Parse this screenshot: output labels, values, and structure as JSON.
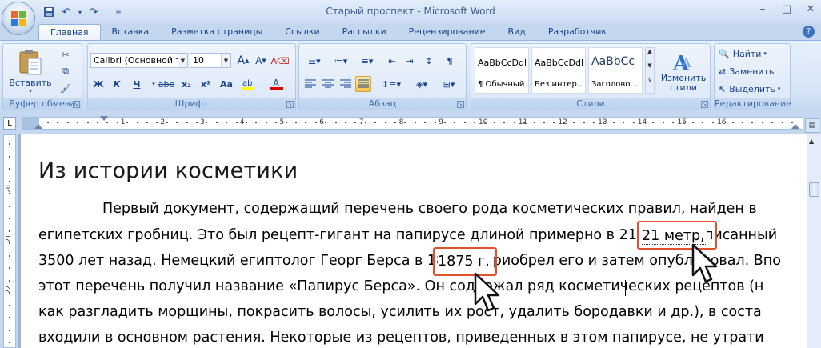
{
  "window": {
    "title": "Старый проспект - Microsoft Word",
    "controls": [
      "–",
      "□",
      "✕"
    ]
  },
  "tabs": [
    "Главная",
    "Вставка",
    "Разметка страницы",
    "Ссылки",
    "Рассылки",
    "Рецензирование",
    "Вид",
    "Разработчик"
  ],
  "ribbon": {
    "clipboard": {
      "label": "Буфер обмена",
      "paste": "Вставить"
    },
    "font": {
      "label": "Шрифт",
      "name": "Calibri (Основной те",
      "size": "10",
      "bold": "Ж",
      "italic": "К",
      "underline": "Ч",
      "strike": "abe",
      "sub": "x₂",
      "sup": "x²",
      "case": "Aa",
      "grow": "A",
      "shrink": "A",
      "clear": "A"
    },
    "paragraph": {
      "label": "Абзац"
    },
    "styles": {
      "label": "Стили",
      "items": [
        {
          "sample": "AaBbCcDdI",
          "name": "¶ Обычный"
        },
        {
          "sample": "AaBbCcDdI",
          "name": "Без интер..."
        },
        {
          "sample": "AaBbCc",
          "name": "Заголово..."
        }
      ],
      "change": "Изменить стили"
    },
    "editing": {
      "label": "Редактирование",
      "find": "Найти",
      "replace": "Заменить",
      "select": "Выделить"
    }
  },
  "ruler": {
    "corner": "L",
    "numbers": [
      "1",
      "2",
      "3",
      "4",
      "5",
      "6",
      "7",
      "8",
      "9",
      "10",
      "11",
      "12",
      "13",
      "14",
      "15",
      "16"
    ],
    "vnumbers": [
      "20",
      "21",
      "22"
    ]
  },
  "document": {
    "title": "Из истории косметики",
    "lines": [
      "Первый документ, содержащий перечень своего рода косметических правил, найден в",
      "египетских гробниц. Это был рецепт-гигант на папирусе длиной примерно в 21 метр, написанный",
      "3500 лет назад. Немецкий египтолог Георг Берса в 1875 г. приобрел его и затем опубликовал. Впо",
      "этот перечень получил название «Папирус Берса». Он содержал ряд косметических рецептов (н",
      "как разгладить морщины, покрасить волосы, усилить их рост, удалить бородавки и др.), в соста",
      "входили в основном растения. Некоторые из рецептов, приведенных в этом папирусе, не утрати"
    ],
    "highlights": [
      "21 метр,",
      "1875 г."
    ]
  },
  "colors": {
    "accent": "#e2502e",
    "ribbon": "#d5e4f6",
    "tab_text": "#15428b"
  }
}
